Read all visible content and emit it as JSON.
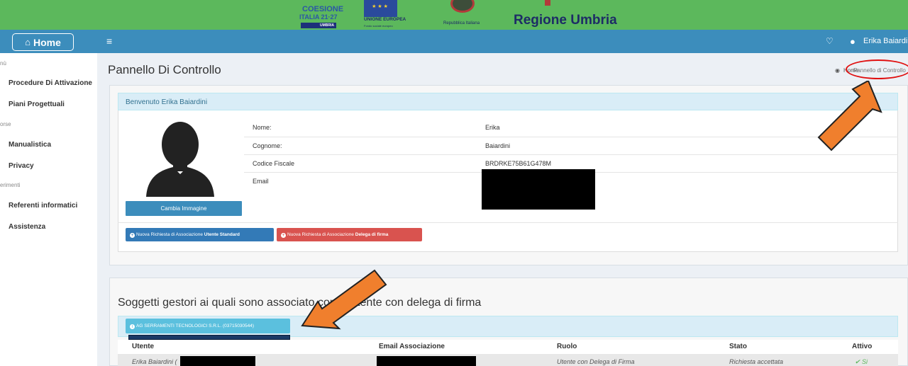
{
  "banner": {
    "coesione_line1": "COESIONE",
    "coesione_line2": "ITALIA 21·27",
    "coesione_line3": "UMBRIA",
    "eu_text": "UNIONE EUROPEA",
    "eu_sub": "Fondo sociale europeo",
    "repubblica": "Repubblica Italiana",
    "regione": "Regione Umbria"
  },
  "nav": {
    "home_label": "Home",
    "menu_icon": "bars-icon",
    "bell_icon": "bell-icon",
    "user_name": "Erika Baiardini"
  },
  "sidebar": {
    "heading_menu": "nù",
    "items_a": [
      "Procedure Di Attivazione",
      "Piani Progettuali"
    ],
    "heading_risorse": "orse",
    "items_b": [
      "Manualistica",
      "Privacy"
    ],
    "heading_riferimenti": "erimenti",
    "items_c": [
      "Referenti informatici",
      "Assistenza"
    ]
  },
  "page": {
    "title": "Pannello Di Controllo",
    "breadcrumb_home": "Home",
    "breadcrumb_current": "Pannello di Controllo"
  },
  "profile": {
    "header": "Benvenuto Erika Baiardini",
    "change_image": "Cambia Immagine",
    "rows": [
      {
        "label": "Nome:",
        "value": "Erika"
      },
      {
        "label": "Cognome:",
        "value": "Baiardini"
      },
      {
        "label": "Codice Fiscale",
        "value": "BRDRKE75B61G478M"
      },
      {
        "label": "Email",
        "value": ""
      }
    ],
    "btn_standard_prefix": "Nuova Richiesta di Associazione ",
    "btn_standard_bold": "Utente Standard",
    "btn_delega_prefix": "Nuova Richiesta di Associazione ",
    "btn_delega_bold": "Delega di firma"
  },
  "associations": {
    "title": "Soggetti gestori ai quali sono associato come Utente con delega di firma",
    "soggetto": "AG SERRAMENTI TECNOLOGICI S.R.L. (03715030544)",
    "columns": [
      "Utente",
      "Email Associazione",
      "Ruolo",
      "Stato",
      "Attivo"
    ],
    "row": {
      "utente": "Erika Baiardini (",
      "ruolo": "Utente con Delega di Firma",
      "stato": "Richiesta accettata",
      "attivo": "Si"
    }
  },
  "colors": {
    "banner": "#5cb85c",
    "navbar": "#3c8dbc",
    "annotation_arrow": "#f07f2d",
    "annotation_circle": "#e01010"
  }
}
